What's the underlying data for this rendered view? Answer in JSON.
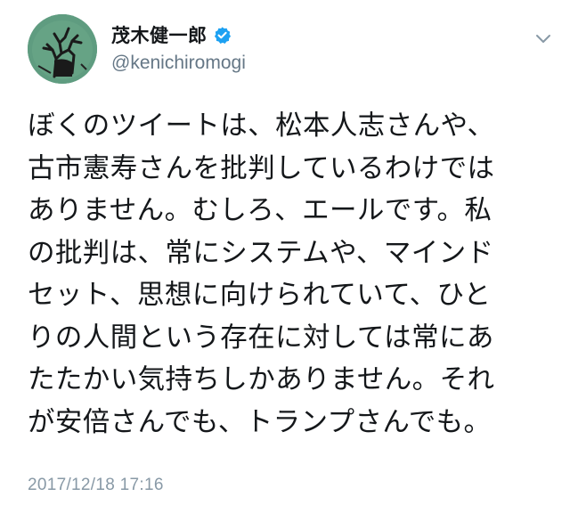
{
  "author": {
    "display_name": "茂木健一郎",
    "handle": "@kenichiromogi",
    "verified": true,
    "avatar_icon": "avatar-drawing-icon"
  },
  "menu": {
    "icon": "chevron-down-icon"
  },
  "tweet": {
    "lines": [
      "ぼくのツイートは、松本人志さんや、",
      "古市憲寿さんを批判しているわけでは",
      "ありません。むしろ、エールです。私",
      "の批判は、常にシステムや、マインド",
      "セット、思想に向けられていて、ひと",
      "りの人間という存在に対しては常にあ",
      "たたかい気持ちしかありません。それ",
      "が安倍さんでも、トランプさんでも。"
    ],
    "timestamp": "2017/12/18 17:16"
  },
  "colors": {
    "text": "#14171a",
    "secondary": "#657786",
    "verified": "#1da1f2",
    "timestamp": "#8899a6"
  }
}
